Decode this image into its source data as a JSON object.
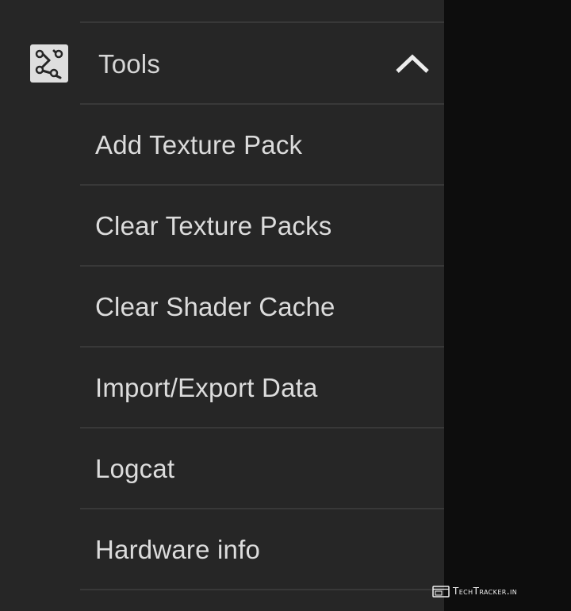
{
  "drawer": {
    "section": {
      "label": "Tools",
      "icon": "tools-icon",
      "expanded": true,
      "toggle_icon": "chevron-up-icon"
    },
    "items": [
      {
        "label": "Add Texture Pack"
      },
      {
        "label": "Clear Texture Packs"
      },
      {
        "label": "Clear Shader Cache"
      },
      {
        "label": "Import/Export Data"
      },
      {
        "label": "Logcat"
      },
      {
        "label": "Hardware info"
      }
    ]
  },
  "watermark": {
    "text": "TechTracker.in"
  },
  "colors": {
    "drawer_background": "#262626",
    "scrim": "#0d0d0d",
    "divider": "#383838",
    "text": "#dcdcdc",
    "icon": "#dedede"
  }
}
